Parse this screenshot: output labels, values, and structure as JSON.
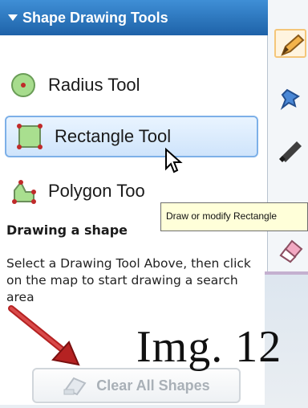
{
  "panel": {
    "title": "Shape Drawing Tools",
    "tools": [
      {
        "label": "Radius Tool",
        "icon": "radius-circle-icon"
      },
      {
        "label": "Rectangle Tool",
        "icon": "rectangle-icon"
      },
      {
        "label": "Polygon Too",
        "icon": "polygon-icon"
      }
    ],
    "help_title": "Drawing a shape",
    "help_text": "Select a Drawing Tool Above, then click on the map to start drawing a search area",
    "clear_button": "Clear All Shapes"
  },
  "tooltip": "Draw or modify Rectangle",
  "figure_label": "Img. 12",
  "right_toolbar": [
    {
      "icon": "pencil-icon"
    },
    {
      "icon": "pushpin-icon"
    },
    {
      "icon": "marker-icon"
    },
    {
      "icon": "eraser-icon"
    }
  ],
  "colors": {
    "header": "#2a74c1",
    "active_bg": "#d8eafc",
    "tooltip_bg": "#ffffd9",
    "arrow": "#b52222"
  }
}
